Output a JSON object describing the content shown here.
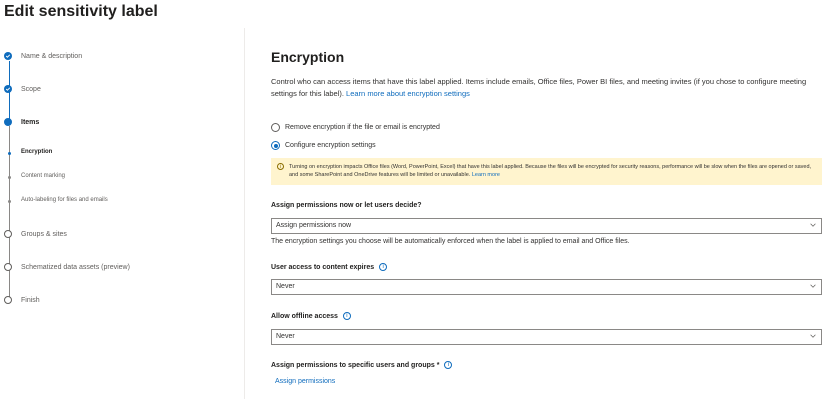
{
  "page_title": "Edit sensitivity label",
  "steps": {
    "name": "Name & description",
    "scope": "Scope",
    "items": "Items",
    "encryption": "Encryption",
    "content_marking": "Content marking",
    "auto_labeling": "Auto-labeling for files and emails",
    "groups": "Groups & sites",
    "schematized": "Schematized data assets (preview)",
    "finish": "Finish"
  },
  "main": {
    "heading": "Encryption",
    "description": "Control who can access items that have this label applied. Items include emails, Office files, Power BI files, and meeting invites (if you chose to configure meeting settings for this label).",
    "learn_more": "Learn more about encryption settings",
    "radio_remove": "Remove encryption if the file or email is encrypted",
    "radio_configure": "Configure encryption settings",
    "warning_text": "Turning on encryption impacts Office files (Word, PowerPoint, Excel) that have this label applied. Because the files will be encrypted for security reasons, performance will be slow when the files are opened or saved, and some SharePoint and OneDrive features will be limited or unavailable.",
    "warning_link": "Learn more",
    "assign_label": "Assign permissions now or let users decide?",
    "assign_value": "Assign permissions now",
    "assign_hint": "The encryption settings you choose will be automatically enforced when the label is applied to email and Office files.",
    "expires_label": "User access to content expires",
    "expires_value": "Never",
    "offline_label": "Allow offline access",
    "offline_value": "Never",
    "specific_label": "Assign permissions to specific users and groups *",
    "assign_link": "Assign permissions"
  },
  "colors": {
    "accent": "#0f6cbd",
    "warning_bg": "#fff4ce"
  }
}
